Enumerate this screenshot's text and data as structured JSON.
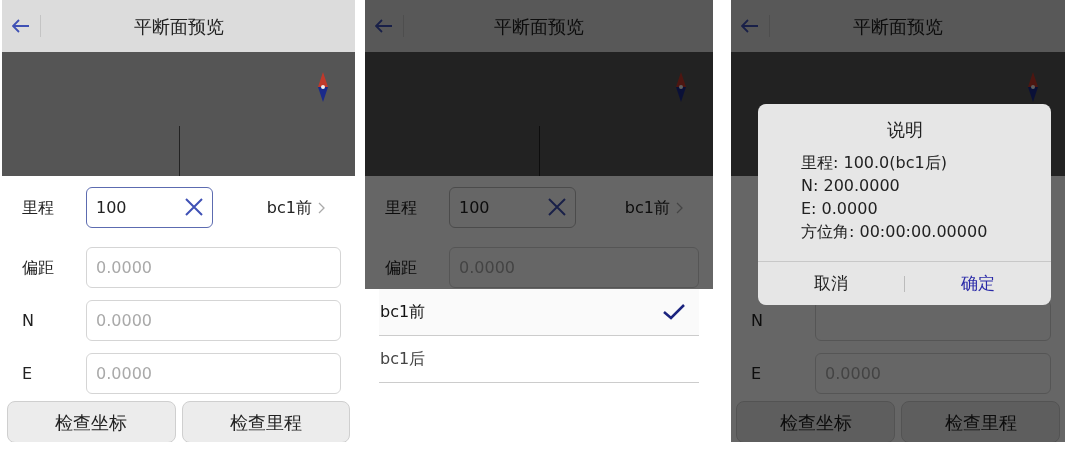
{
  "screens": [
    {
      "kind": "plain",
      "title": "平断面预览",
      "rows": [
        {
          "kind": "mileage",
          "label": "里程",
          "value": "100",
          "focused": true,
          "side": "bc1前"
        },
        {
          "kind": "field",
          "label": "偏距",
          "placeholder": "0.0000"
        },
        {
          "kind": "field",
          "label": "N",
          "placeholder": "0.0000"
        },
        {
          "kind": "field",
          "label": "E",
          "placeholder": "0.0000"
        }
      ],
      "buttons": [
        "检查坐标",
        "检查里程"
      ]
    },
    {
      "kind": "sheet",
      "title": "平断面预览",
      "rows": [
        {
          "kind": "mileage",
          "label": "里程",
          "value": "100",
          "focused": false,
          "side": "bc1前"
        },
        {
          "kind": "field",
          "label": "偏距",
          "placeholder": "0.0000"
        }
      ],
      "options": [
        {
          "label": "bc1前",
          "selected": true
        },
        {
          "label": "bc1后",
          "selected": false
        }
      ]
    },
    {
      "kind": "dialog",
      "title": "平断面预览",
      "rows": [
        {
          "kind": "covered"
        },
        {
          "kind": "covered"
        },
        {
          "kind": "field",
          "label": "N"
        },
        {
          "kind": "field",
          "label": "E",
          "placeholder": "0.0000"
        }
      ],
      "buttons": [
        "检查坐标",
        "检查里程"
      ],
      "dialog": {
        "title": "说明",
        "lines": [
          "里程: 100.0(bc1后)",
          "N: 200.0000",
          "E: 0.0000",
          "方位角: 00:00:00.00000"
        ],
        "actions": [
          {
            "label": "取消",
            "kind": "cancel"
          },
          {
            "label": "确定",
            "kind": "confirm"
          }
        ]
      }
    }
  ]
}
